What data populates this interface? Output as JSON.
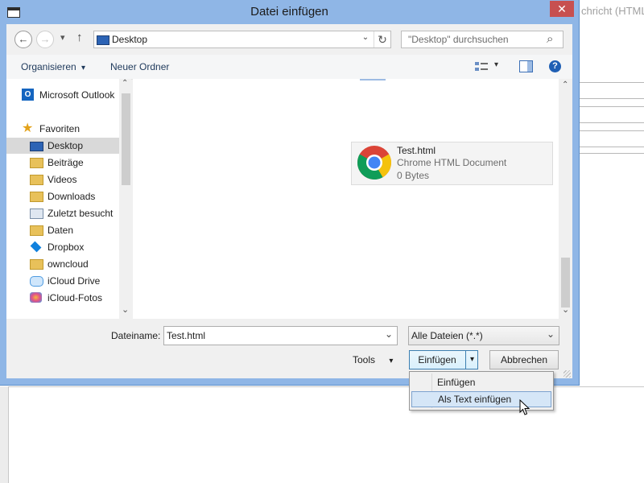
{
  "background_app": {
    "title_fragment": "chricht (HTML)"
  },
  "dialog": {
    "title": "Datei einfügen",
    "close_glyph": "✕"
  },
  "nav": {
    "back_glyph": "←",
    "forward_glyph": "→",
    "recent_glyph": "▾",
    "up_glyph": "↑",
    "address": "Desktop",
    "address_dropdown_glyph": "⌄",
    "refresh_glyph": "↻",
    "search_placeholder": "\"Desktop\" durchsuchen",
    "search_glyph": "⌕"
  },
  "toolbar": {
    "organize": "Organisieren",
    "organize_arrow": "▾",
    "new_folder": "Neuer Ordner",
    "view_arrow": "▾",
    "help_glyph": "?"
  },
  "sidebar": {
    "outlook": "Microsoft Outlook",
    "favorites": "Favoriten",
    "items": [
      {
        "label": "Desktop",
        "icon": "desktop-icon"
      },
      {
        "label": "Beiträge",
        "icon": "folder-icon"
      },
      {
        "label": "Videos",
        "icon": "folder-icon"
      },
      {
        "label": "Downloads",
        "icon": "downloads-folder-icon"
      },
      {
        "label": "Zuletzt besucht",
        "icon": "recent-places-icon"
      },
      {
        "label": "Daten",
        "icon": "folder-icon"
      },
      {
        "label": "Dropbox",
        "icon": "dropbox-icon"
      },
      {
        "label": "owncloud",
        "icon": "folder-icon"
      },
      {
        "label": "iCloud Drive",
        "icon": "icloud-drive-icon"
      },
      {
        "label": "iCloud-Fotos",
        "icon": "icloud-photos-icon"
      }
    ],
    "scroll_up": "⌃",
    "scroll_down": "⌄"
  },
  "files": [
    {
      "name": "Test.html",
      "type": "Chrome HTML Document",
      "size": "0 Bytes",
      "icon": "chrome-icon"
    }
  ],
  "filename": {
    "label": "Dateiname:",
    "value": "Test.html",
    "dd_glyph": "⌄"
  },
  "filetype": {
    "value": "Alle Dateien (*.*)",
    "dd_glyph": "⌄"
  },
  "buttons": {
    "tools": "Tools",
    "tools_arrow": "▾",
    "insert": "Einfügen",
    "insert_arrow": "▾",
    "cancel": "Abbrechen"
  },
  "menu": {
    "items": [
      "Einfügen",
      "Als Text einfügen"
    ],
    "highlighted_index": 1
  },
  "colors": {
    "title_bar": "#8fb6e6",
    "close_button": "#c75050",
    "selection": "#cce8ff",
    "accent": "#2c63b5"
  }
}
